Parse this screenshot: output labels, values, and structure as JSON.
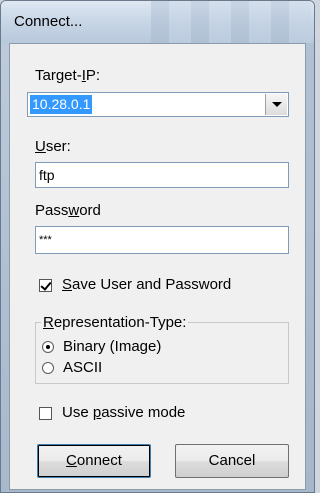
{
  "window": {
    "title": "Connect..."
  },
  "target_ip": {
    "label_pre": "Target-",
    "label_key": "I",
    "label_post": "P:",
    "value": "10.28.0.1"
  },
  "user": {
    "label_key": "U",
    "label_post": "ser:",
    "value": "ftp"
  },
  "password": {
    "label_pre": "Pass",
    "label_key": "w",
    "label_post": "ord",
    "value": "***"
  },
  "save_credentials": {
    "label_key": "S",
    "label_post": "ave User and Password",
    "checked": true
  },
  "representation": {
    "label_key": "R",
    "label_post": "epresentation-Type:",
    "options": [
      {
        "label": "Binary (Image)",
        "selected": true
      },
      {
        "label": "ASCII",
        "selected": false
      }
    ]
  },
  "passive_mode": {
    "label_pre": "Use ",
    "label_key": "p",
    "label_post": "assive mode",
    "checked": false
  },
  "buttons": {
    "connect_key": "C",
    "connect_post": "onnect",
    "cancel": "Cancel"
  }
}
